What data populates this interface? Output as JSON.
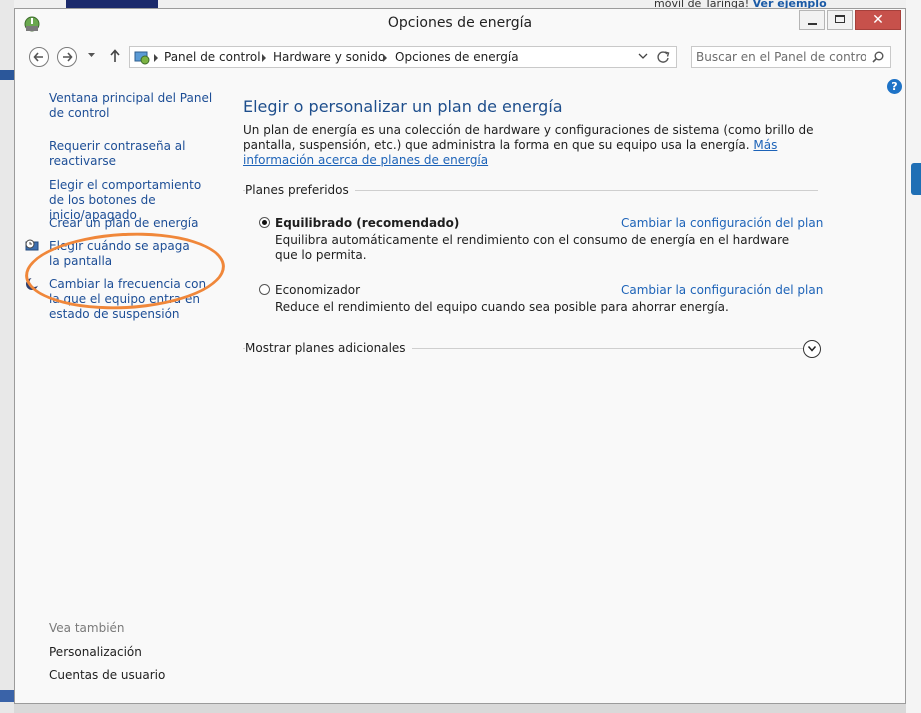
{
  "background": {
    "snippet_text": "móvil de Taringa!",
    "snippet_link": "Ver ejemplo"
  },
  "window": {
    "title": "Opciones de energía",
    "close_glyph": "✕"
  },
  "address": {
    "crumbs": [
      "Panel de control",
      "Hardware y sonido",
      "Opciones de energía"
    ]
  },
  "search": {
    "placeholder": "Buscar en el Panel de control"
  },
  "help": {
    "glyph": "?"
  },
  "sidebar": {
    "items": [
      {
        "label": "Ventana principal del Panel de control",
        "icon": ""
      },
      {
        "label": "Requerir contraseña al reactivarse",
        "icon": ""
      },
      {
        "label": "Elegir el comportamiento de los botones de inicio/apagado",
        "icon": ""
      },
      {
        "label": "Crear un plan de energía",
        "icon": ""
      },
      {
        "label": "Elegir cuándo se apaga la pantalla",
        "icon": "clock-monitor-icon"
      },
      {
        "label": "Cambiar la frecuencia con la que el equipo entra en estado de suspensión",
        "icon": "moon-icon"
      }
    ],
    "see_also": {
      "title": "Vea también",
      "items": [
        "Personalización",
        "Cuentas de usuario"
      ]
    }
  },
  "main": {
    "heading": "Elegir o personalizar un plan de energía",
    "intro": "Un plan de energía es una colección de hardware y configuraciones de sistema (como brillo de pantalla, suspensión, etc.) que administra la forma en que su equipo usa la energía.",
    "intro_link": "Más información acerca de planes de energía",
    "preferred_title": "Planes preferidos",
    "plans": [
      {
        "name": "Equilibrado (recomendado)",
        "selected": true,
        "change_link": "Cambiar la configuración del plan",
        "description": "Equilibra automáticamente el rendimiento con el consumo de energía en el hardware que lo permita."
      },
      {
        "name": "Economizador",
        "selected": false,
        "change_link": "Cambiar la configuración del plan",
        "description": "Reduce el rendimiento del equipo cuando sea posible para ahorrar energía."
      }
    ],
    "more_plans": "Mostrar planes adicionales"
  },
  "colors": {
    "link": "#1d4e96",
    "heading": "#1e4e8c",
    "highlight_annotation": "#f0873a",
    "close_button": "#c7514b"
  }
}
